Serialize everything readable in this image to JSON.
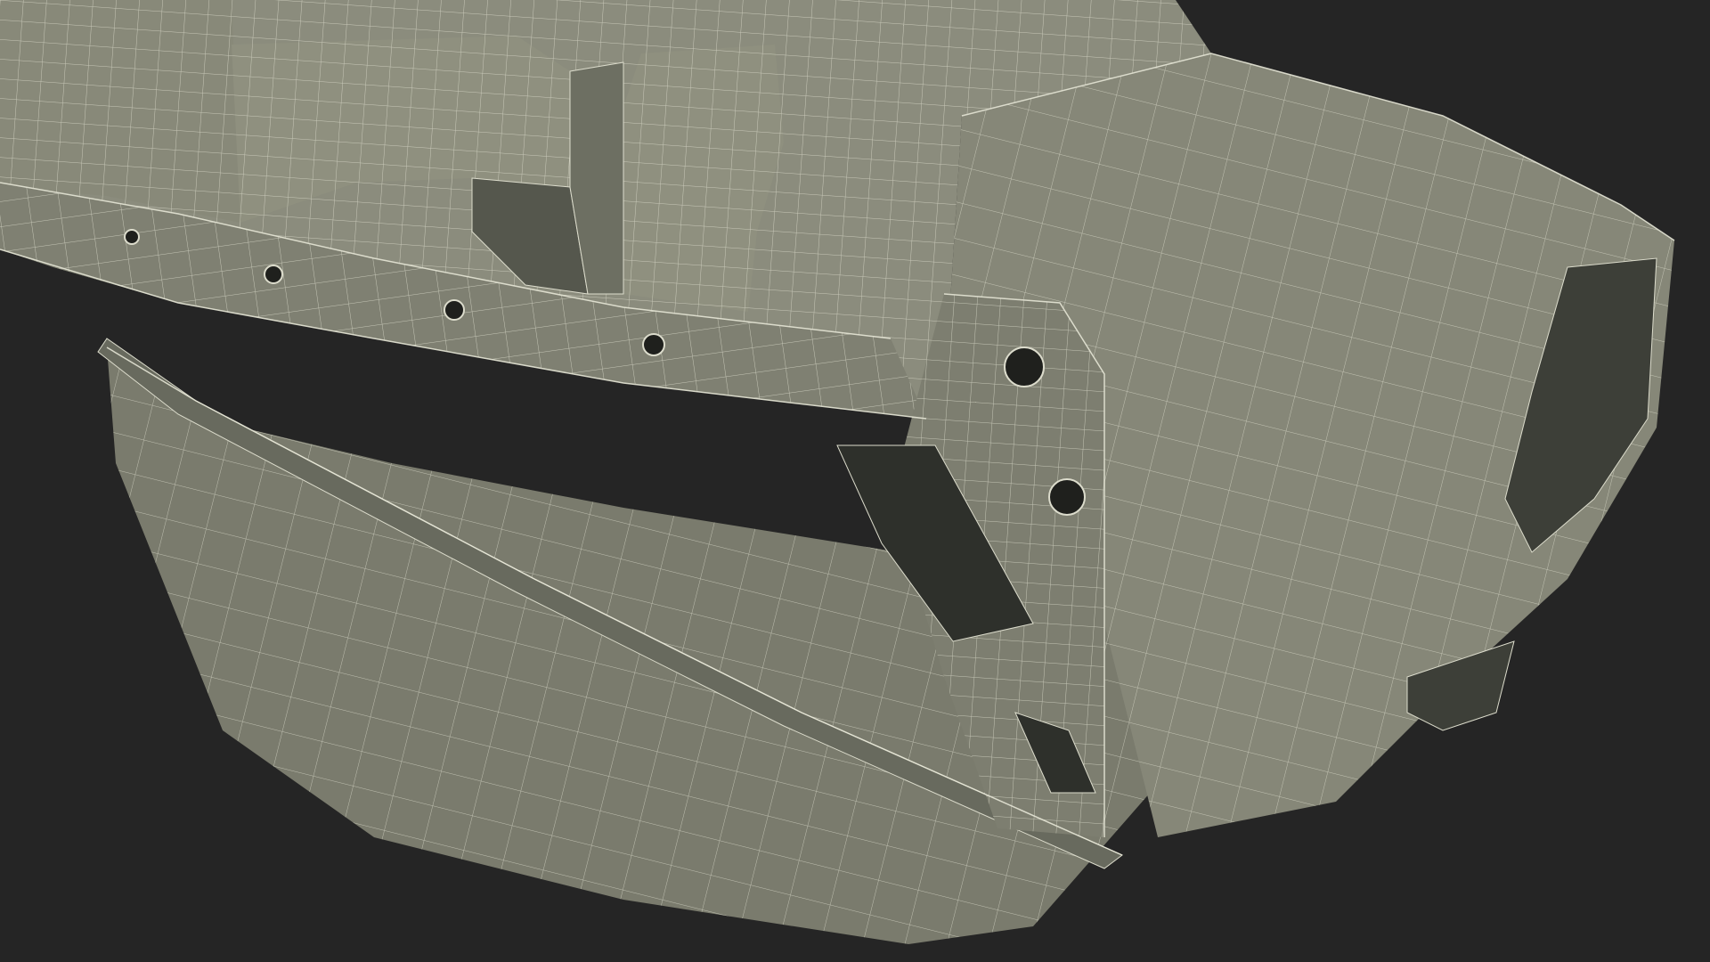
{
  "scene": {
    "subject": "wireframe-3d-model",
    "colors": {
      "background": "#252525",
      "surface_light": "#898a7b",
      "surface_mid": "#7b7c6e",
      "surface_dark": "#5f6056",
      "cavity": "#2e302b",
      "wire": "#dcdccc"
    }
  }
}
